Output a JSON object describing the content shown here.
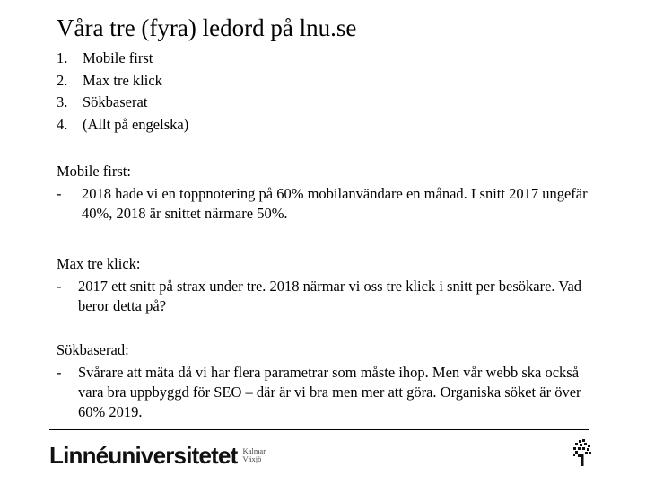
{
  "slide": {
    "title": "Våra tre (fyra) ledord på lnu.se",
    "numbered_list": [
      {
        "num": "1.",
        "text": "Mobile first"
      },
      {
        "num": "2.",
        "text": "Max tre klick"
      },
      {
        "num": "3.",
        "text": "Sökbaserat"
      },
      {
        "num": "4.",
        "text": "(Allt på engelska)"
      }
    ],
    "sections": [
      {
        "heading": "Mobile first:",
        "bullet_marker": "-",
        "bullet": "2018 hade vi en toppnotering på 60% mobilanvändare en månad. I snitt 2017 ungefär 40%, 2018 är snittet närmare 50%."
      },
      {
        "heading": "Max tre klick:",
        "bullet_marker": "-",
        "bullet": "2017 ett snitt på strax under tre. 2018 närmar vi oss tre klick i snitt per besökare. Vad beror detta på?"
      },
      {
        "heading": "Sökbaserad:",
        "bullet_marker": "-",
        "bullet": "Svårare att mäta då vi har flera parametrar som måste ihop. Men vår webb ska också vara bra uppbyggd för SEO – där är vi bra men mer att göra. Organiska söket är över 60% 2019."
      }
    ],
    "footer": {
      "logo_text": "Linnéuniversitetet",
      "logo_city_1": "Kalmar",
      "logo_city_2": "Växjö",
      "tree_icon": "tree-icon"
    }
  }
}
